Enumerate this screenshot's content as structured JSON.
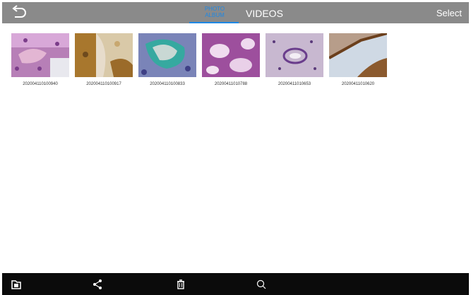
{
  "header": {
    "tabs": [
      {
        "label": "PHOTO\nALBUM",
        "active": true
      },
      {
        "label": "VIDEOS",
        "active": false
      }
    ],
    "select_label": "Select",
    "accent_color": "#1e88e5"
  },
  "gallery": {
    "items": [
      {
        "caption": "202004110100940"
      },
      {
        "caption": "202004110100917"
      },
      {
        "caption": "202004110100833"
      },
      {
        "caption": "20200411010788"
      },
      {
        "caption": "20200411010653"
      },
      {
        "caption": "20200411010620"
      }
    ]
  },
  "bottom_bar": {
    "icons": [
      "folder-icon",
      "share-icon",
      "trash-icon",
      "search-icon"
    ]
  }
}
